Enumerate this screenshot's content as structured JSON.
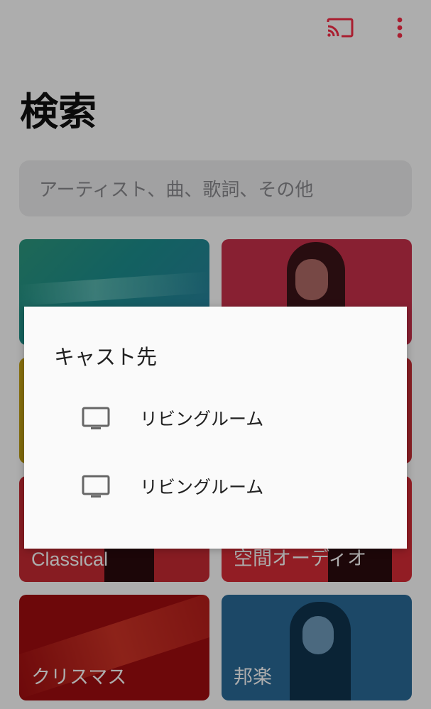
{
  "app": {
    "accent_color": "#fa2d48"
  },
  "header": {
    "title": "検索",
    "cast_icon": "cast-icon",
    "more_icon": "more-vertical-icon"
  },
  "search": {
    "placeholder": "アーティスト、曲、歌詞、その他"
  },
  "categories": [
    {
      "label": "",
      "color": "#1d8d8d"
    },
    {
      "label": "",
      "color": "#c9304b"
    },
    {
      "label": "",
      "color": "#b89a10"
    },
    {
      "label": "",
      "color": "#c72e36"
    },
    {
      "label": "Classical",
      "color": "#c72a33"
    },
    {
      "label": "空間オーディオ",
      "color": "#d72b35"
    },
    {
      "label": "クリスマス",
      "color": "#a10d10"
    },
    {
      "label": "邦楽",
      "color": "#2a6a99"
    }
  ],
  "cast_dialog": {
    "title": "キャスト先",
    "devices": [
      {
        "name": "リビングルーム",
        "icon": "tv-icon"
      },
      {
        "name": "リビングルーム",
        "icon": "tv-icon"
      }
    ]
  }
}
